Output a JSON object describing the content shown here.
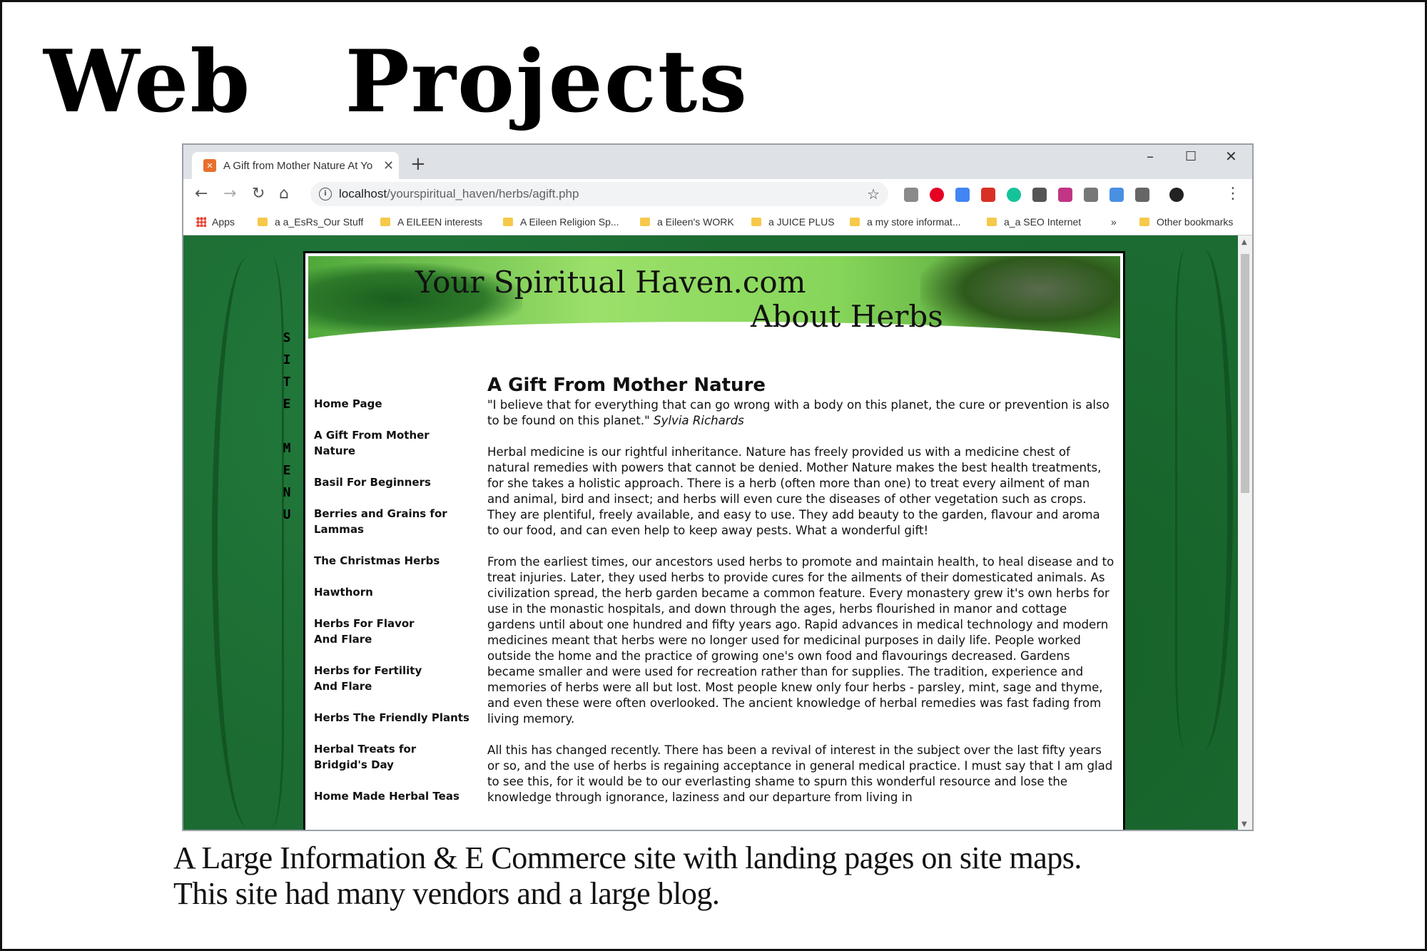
{
  "slide": {
    "title": "Web   Projects",
    "caption_lines": [
      "A Large Information & E Commerce site with landing pages on site maps.",
      "This site had many vendors and a large blog."
    ]
  },
  "browser": {
    "tab": {
      "title": "A Gift from Mother Nature At Yo",
      "favicon": "xampp-icon"
    },
    "address": {
      "host": "localhost",
      "path": "/yourspiritual_haven/herbs/agift.php"
    },
    "bookmarks": [
      {
        "label": "Apps",
        "type": "apps"
      },
      {
        "label": "a a_EsRs_Our Stuff",
        "type": "folder"
      },
      {
        "label": "A EILEEN interests",
        "type": "folder"
      },
      {
        "label": "A Eileen Religion Sp...",
        "type": "folder"
      },
      {
        "label": "a Eileen's WORK",
        "type": "folder"
      },
      {
        "label": "a JUICE PLUS",
        "type": "folder"
      },
      {
        "label": "a my store informat...",
        "type": "folder"
      },
      {
        "label": "a_a SEO Internet",
        "type": "folder"
      },
      {
        "label": "»",
        "type": "overflow"
      },
      {
        "label": "Other bookmarks",
        "type": "folder"
      }
    ],
    "extension_colors": [
      "#8a8a8a",
      "#e60023",
      "#4285f4",
      "#d93025",
      "#15c39a",
      "#555555",
      "#c13584",
      "#777777",
      "#4a90e2",
      "#666666"
    ]
  },
  "site": {
    "banner_title": "Your Spiritual Haven.com",
    "banner_subtitle": "About Herbs",
    "vertical_menu": [
      "S",
      "I",
      "T",
      "E",
      "",
      "M",
      "E",
      "N",
      "U"
    ],
    "nav": [
      "Home Page",
      "A Gift From Mother Nature",
      "Basil For Beginners",
      "Berries and Grains for Lammas",
      "The Christmas Herbs",
      "Hawthorn",
      "Herbs For Flavor And Flare",
      "Herbs for Fertility And Flare",
      "Herbs The Friendly Plants",
      "Herbal Treats for Bridgid's Day",
      "Home Made Herbal Teas"
    ],
    "article": {
      "heading": "A Gift From Mother Nature",
      "quote": "\"I believe that for everything that can go wrong with a body on this planet, the cure or prevention is also to be found on this planet.\"",
      "quote_author": "Sylvia Richards",
      "paragraphs": [
        "Herbal medicine is our rightful inheritance. Nature has freely provided us with a medicine chest of natural remedies with powers that cannot be denied. Mother Nature makes the best health treatments, for she takes a holistic approach. There is a herb (often more than one) to treat every ailment of man and animal, bird and insect; and herbs will even cure the diseases of other vegetation such as crops. They are plentiful, freely available, and easy to use. They add beauty to the garden, flavour and aroma to our food, and can even help to keep away pests. What a wonderful gift!",
        "From the earliest times, our ancestors used herbs to promote and maintain health, to heal disease and to treat injuries. Later, they used herbs to provide cures for the ailments of their domesticated animals. As civilization spread, the herb garden became a common feature. Every monastery grew it's own herbs for use in the monastic hospitals, and down through the ages, herbs flourished in manor and cottage gardens until about one hundred and fifty years ago. Rapid advances in medical technology and modern medicines meant that herbs were no longer used for medicinal purposes in daily life. People worked outside the home and the practice of growing one's own food and flavourings decreased. Gardens became smaller and were used for recreation rather than for supplies. The tradition, experience and memories of herbs were all but lost. Most people knew only four herbs - parsley, mint, sage and thyme, and even these were often overlooked. The ancient knowledge of herbal remedies was fast fading from living memory.",
        "All this has changed recently. There has been a revival of interest in the subject over the last fifty years or so, and the use of herbs is regaining acceptance in general medical practice. I must say that I am glad to see this, for it would be to our everlasting shame to spurn this wonderful resource and lose the knowledge through ignorance, laziness and our departure from living in"
      ]
    }
  }
}
